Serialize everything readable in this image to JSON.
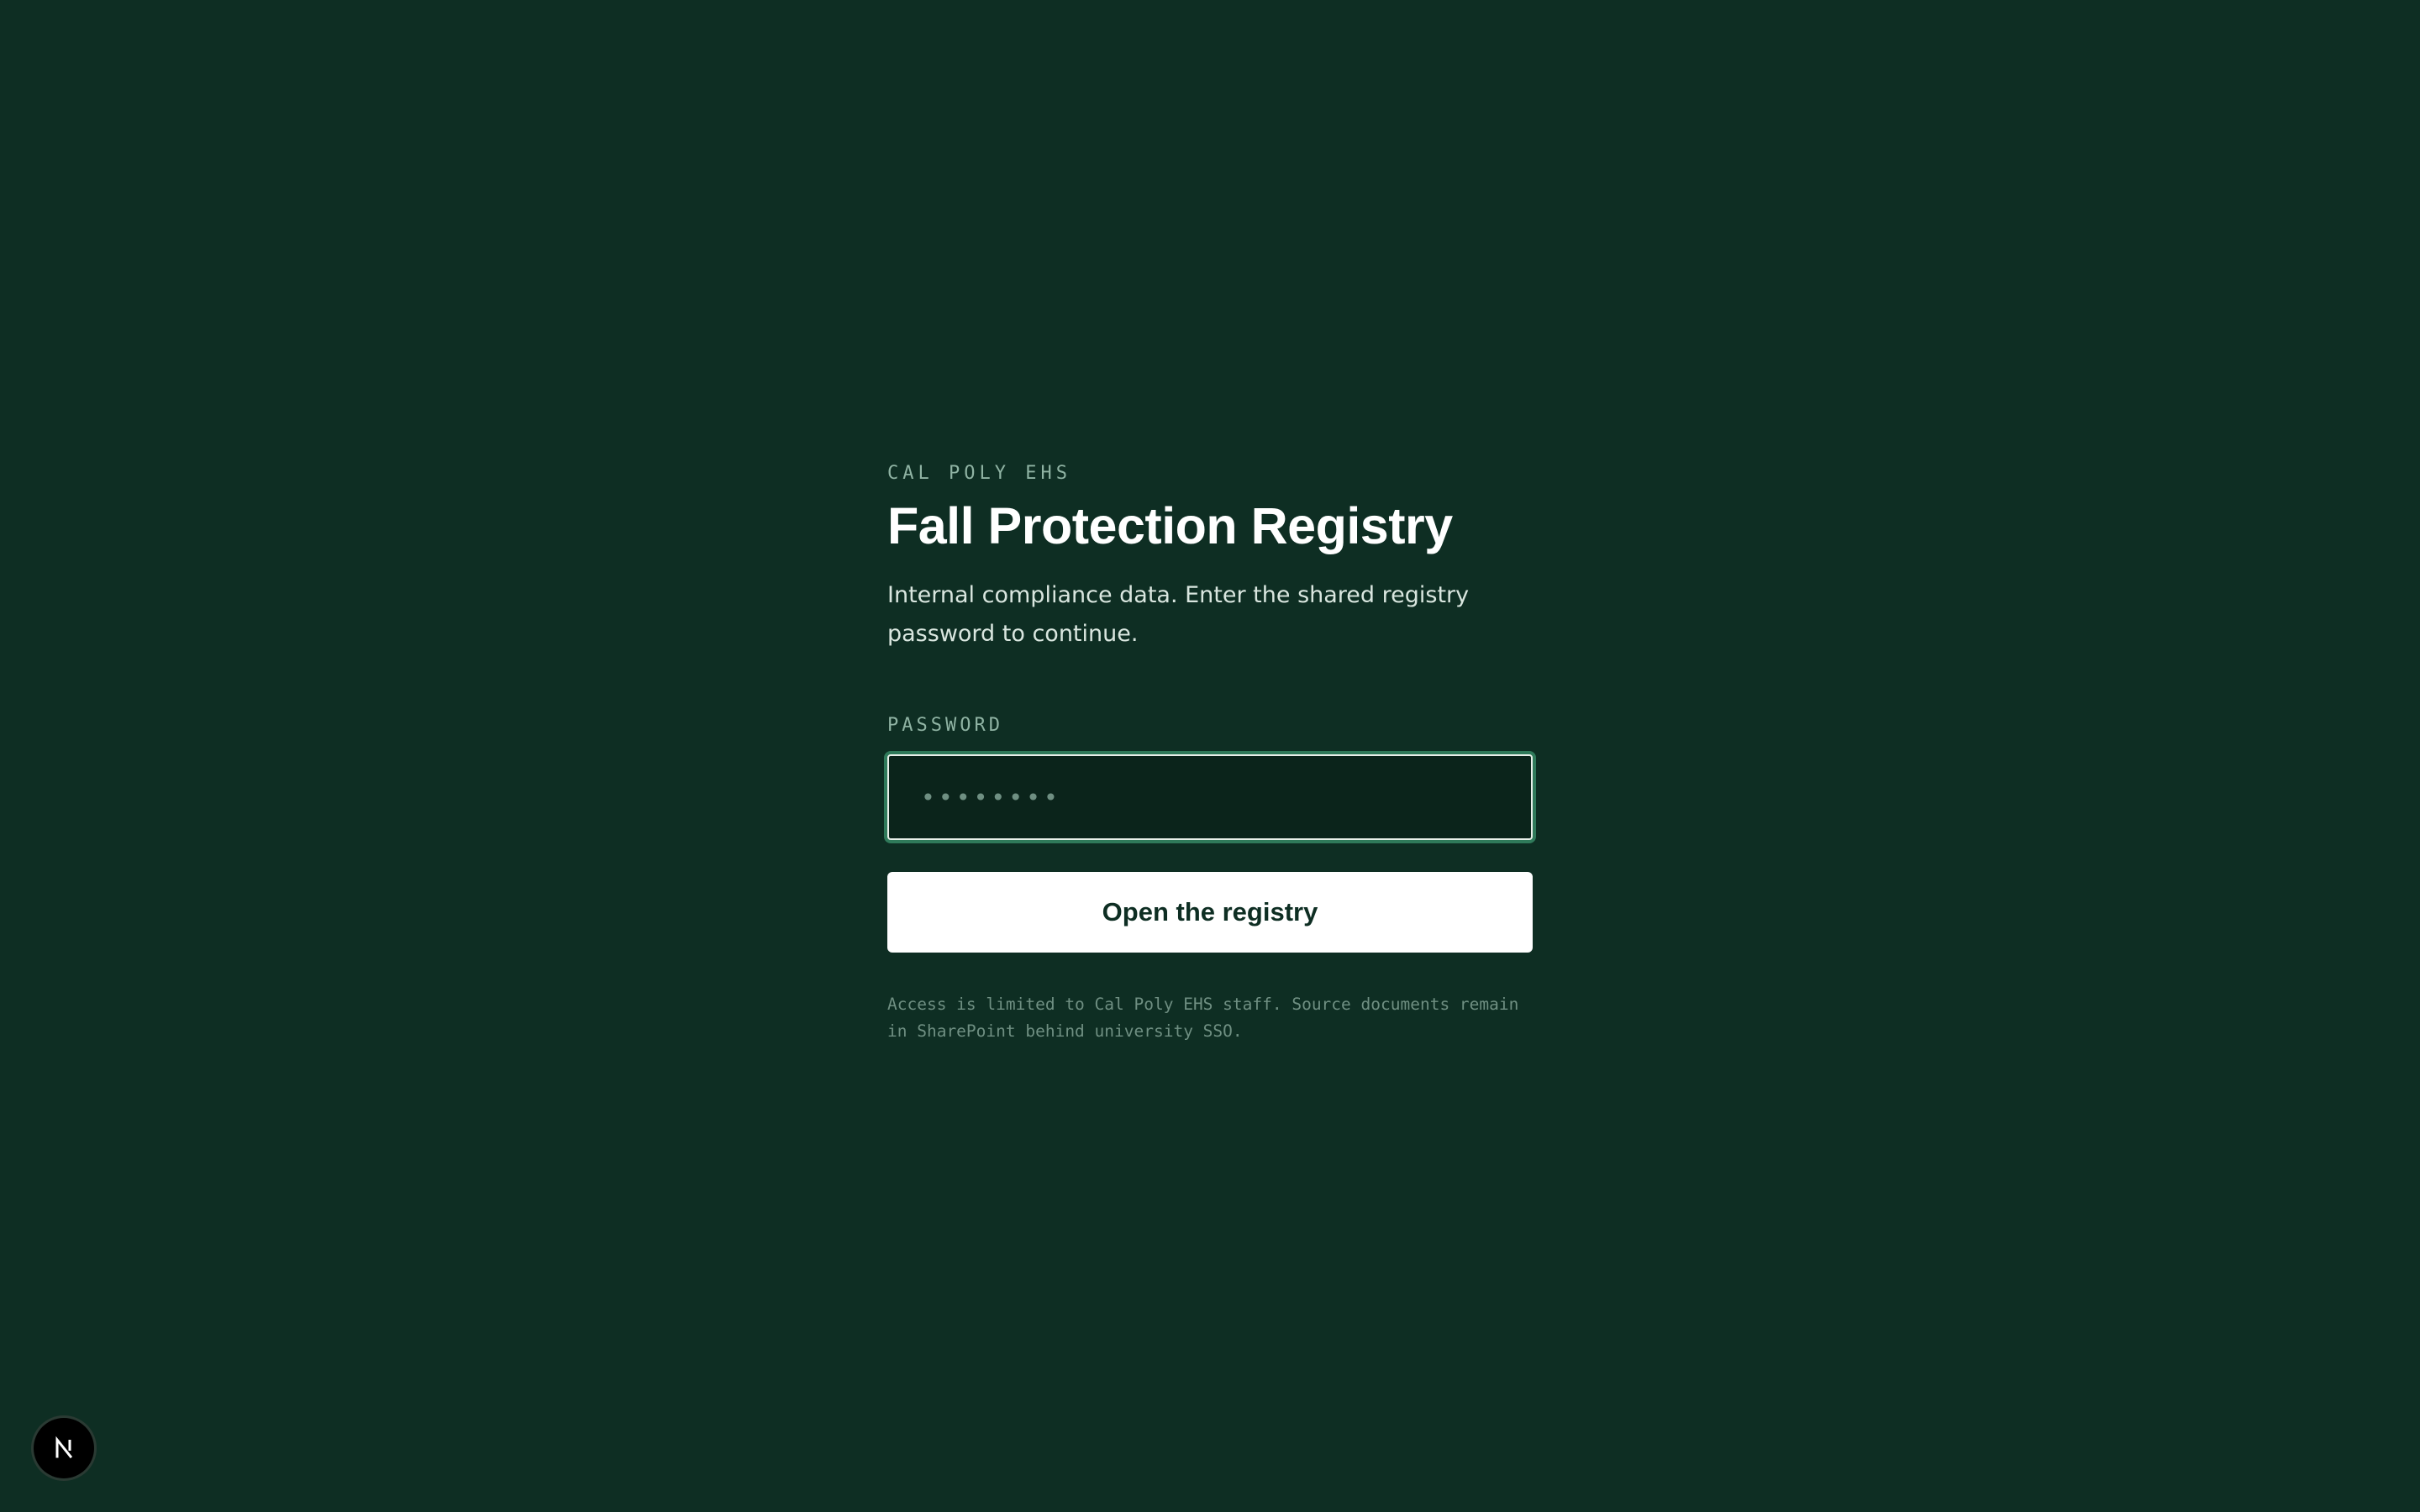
{
  "header": {
    "eyebrow": "CAL POLY EHS",
    "title": "Fall Protection Registry",
    "subtitle": "Internal compliance data. Enter the shared registry password to continue."
  },
  "form": {
    "password_label": "PASSWORD",
    "password_placeholder": "••••••••",
    "password_value": "",
    "submit_label": "Open the registry"
  },
  "footnote": "Access is limited to Cal Poly EHS staff. Source documents remain in SharePoint behind university SSO.",
  "badge": {
    "icon": "nextjs-logo-icon"
  },
  "colors": {
    "background": "#0e2e23",
    "accent": "#2f7a5a",
    "button_bg": "#ffffff",
    "muted_text": "#8fb3a3"
  }
}
